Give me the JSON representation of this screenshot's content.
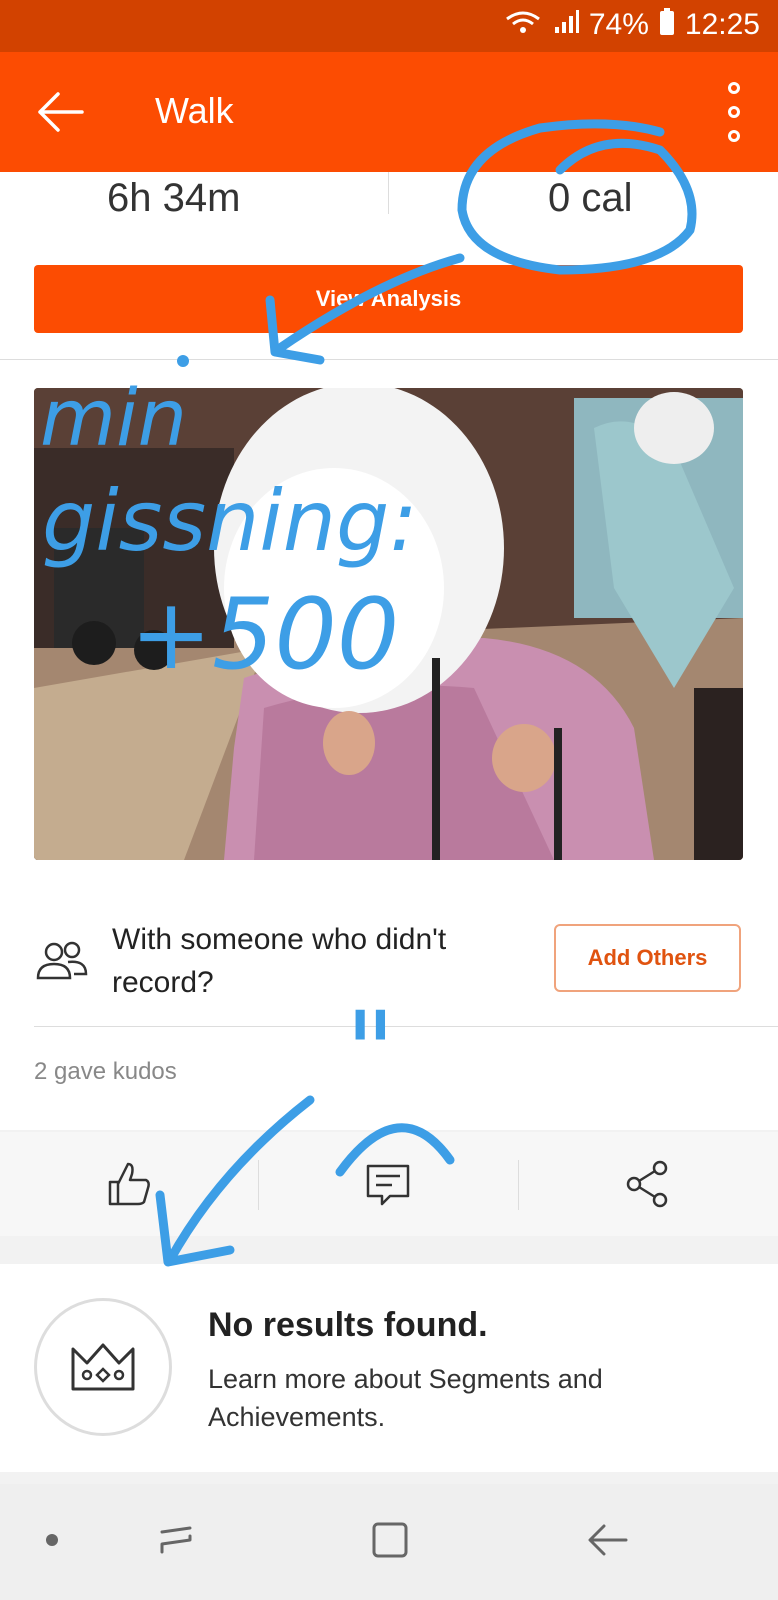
{
  "status": {
    "battery": "74%",
    "time": "12:25"
  },
  "header": {
    "title": "Walk"
  },
  "stats": {
    "duration": "6h 34m",
    "calories": "0 cal"
  },
  "view_analysis": "View Analysis",
  "together": {
    "prompt": "With someone who didn't record?",
    "button": "Add Others"
  },
  "kudos": "2 gave kudos",
  "segments": {
    "title": "No results found.",
    "subtitle": "Learn more about Segments and Achievements."
  },
  "annotations": {
    "line1": "min",
    "line2": "gissning:",
    "line3": "+500",
    "mark": "\""
  },
  "colors": {
    "accent": "#fc4c02",
    "statusbar": "#d24200",
    "annotation": "#3d9ee6"
  }
}
